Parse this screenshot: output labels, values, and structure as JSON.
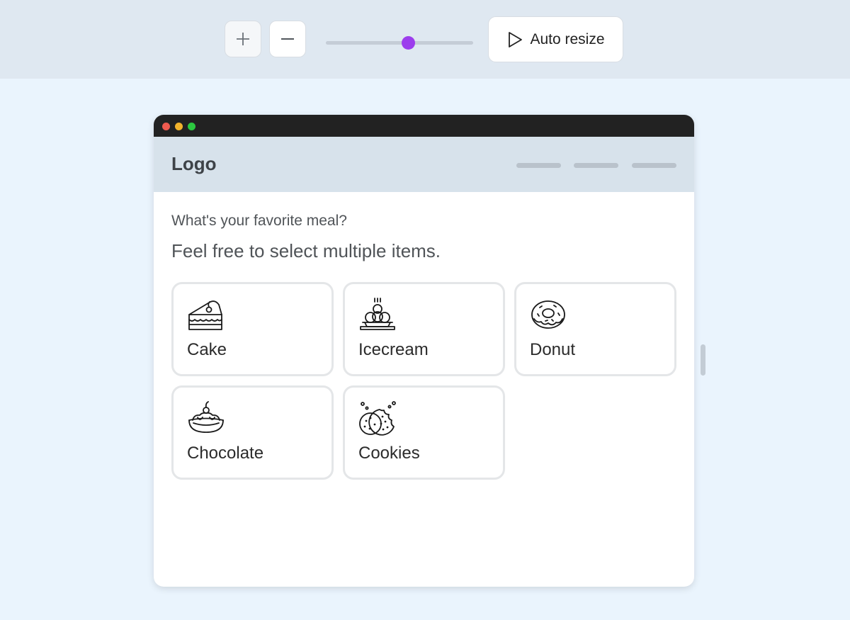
{
  "toolbar": {
    "zoom_in_icon": "plus-icon",
    "zoom_out_icon": "minus-icon",
    "slider_level": 0.56,
    "slider_color": "#9c3ded",
    "auto_resize_label": "Auto resize"
  },
  "site": {
    "logo": "Logo",
    "nav_items": [
      "",
      "",
      ""
    ]
  },
  "form": {
    "question": "What's your favorite meal?",
    "subtitle": "Feel free to select multiple items.",
    "options": [
      {
        "label": "Cake",
        "icon": "cake-icon"
      },
      {
        "label": "Icecream",
        "icon": "icecream-icon"
      },
      {
        "label": "Donut",
        "icon": "donut-icon"
      },
      {
        "label": "Chocolate",
        "icon": "chocolate-icon"
      },
      {
        "label": "Cookies",
        "icon": "cookies-icon"
      }
    ]
  }
}
